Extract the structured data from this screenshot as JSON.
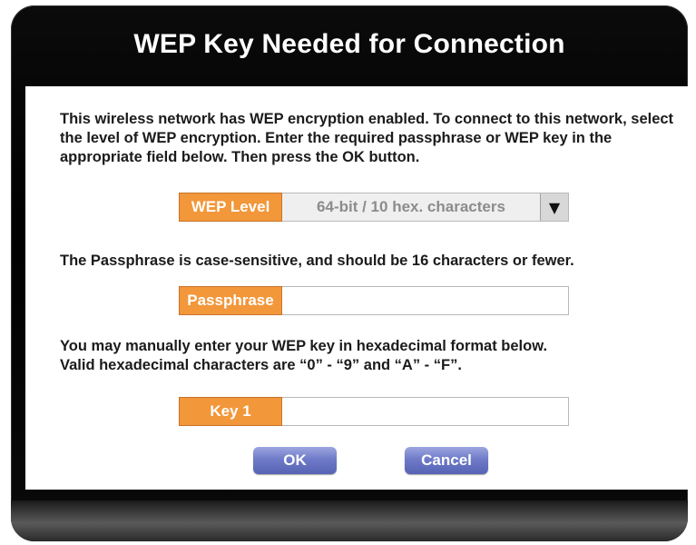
{
  "dialog": {
    "title": "WEP Key Needed for Connection",
    "intro_text": "This wireless network has WEP encryption enabled. To connect to this network, select the level of WEP encryption. Enter the required passphrase or WEP key in the appropriate field below. Then press the OK button.",
    "passphrase_hint": "The Passphrase is case-sensitive, and should be 16 characters or fewer.",
    "hex_hint_line1": "You may manually enter your WEP key in hexadecimal format below.",
    "hex_hint_line2": "Valid hexadecimal characters are “0” - “9” and “A” - “F”."
  },
  "wep_level": {
    "label": "WEP Level",
    "selected": "64-bit / 10 hex. characters",
    "arrow_icon": "triangle-down-icon"
  },
  "passphrase": {
    "label": "Passphrase",
    "value": ""
  },
  "key1": {
    "label": "Key 1",
    "value": ""
  },
  "buttons": {
    "ok": "OK",
    "cancel": "Cancel"
  },
  "colors": {
    "label_orange": "#f2973a",
    "button_blue": "#6f7bc8",
    "frame_black": "#000000"
  }
}
